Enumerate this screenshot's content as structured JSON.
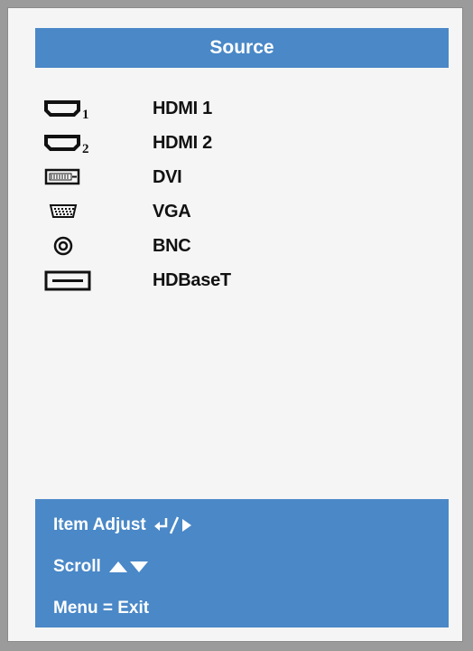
{
  "title": "Source",
  "sources": [
    {
      "label": "HDMI 1",
      "icon": "hdmi-1-icon"
    },
    {
      "label": "HDMI 2",
      "icon": "hdmi-2-icon"
    },
    {
      "label": "DVI",
      "icon": "dvi-icon"
    },
    {
      "label": "VGA",
      "icon": "vga-icon"
    },
    {
      "label": "BNC",
      "icon": "bnc-icon"
    },
    {
      "label": "HDBaseT",
      "icon": "hdbaset-icon"
    }
  ],
  "help": {
    "item_adjust": "Item Adjust",
    "scroll": "Scroll",
    "menu_exit": "Menu = Exit"
  },
  "icon_badges": {
    "hdmi1": "1",
    "hdmi2": "2"
  },
  "colors": {
    "panel_blue": "#4a88c7",
    "background": "#f5f5f5",
    "frame": "#9b9b9b"
  }
}
